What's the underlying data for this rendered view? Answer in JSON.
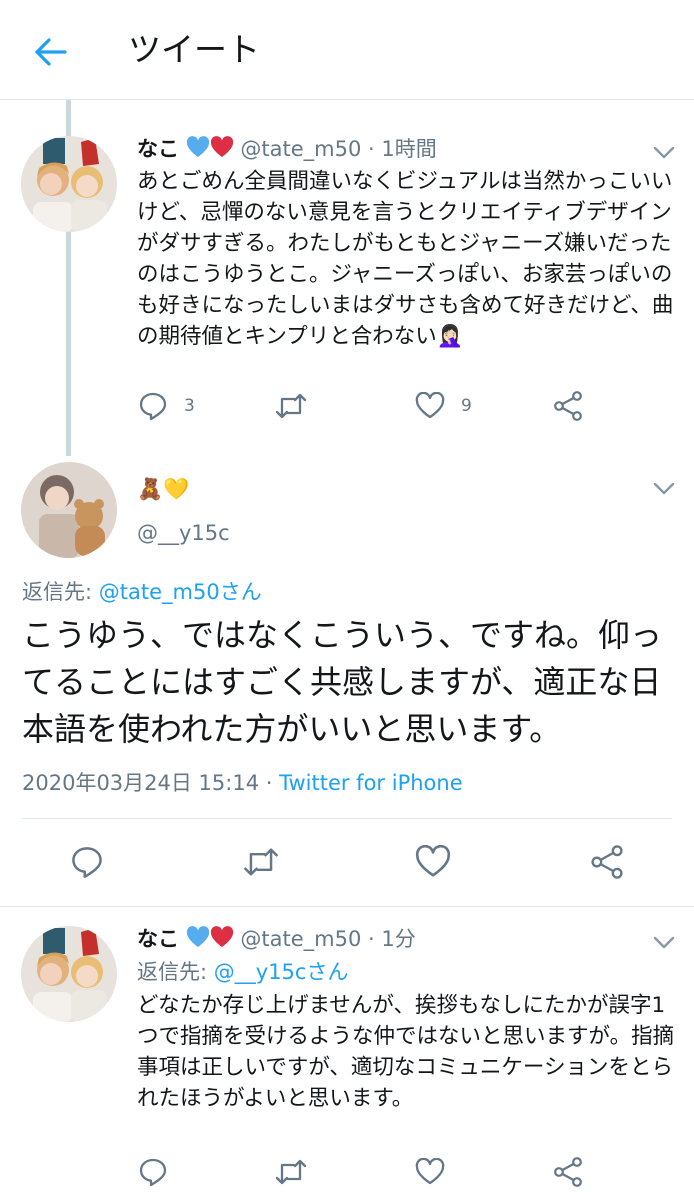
{
  "header": {
    "title": "ツイート"
  },
  "tweets": [
    {
      "name": "なこ",
      "handle": "@tate_m50",
      "time": "· 1時間",
      "text": "あとごめん全員間違いなくビジュアルは当然かっこいいけど、忌憚のない意見を言うとクリエイティブデザインがダサすぎる。わたしがもともとジャニーズ嫌いだったのはこうゆうとこ。ジャニーズっぽい、お家芸っぽいのも好きになったしいまはダサさも含めて好きだけど、曲の期待値とキンプリと合わない🤦🏻‍♀️",
      "replies": "3",
      "likes": "9"
    },
    {
      "name": "🧸💛",
      "handle": "@__y15c",
      "reply_prefix": "返信先: ",
      "reply_to": "@tate_m50さん",
      "text": "こうゆう、ではなくこういう、ですね。仰ってることにはすごく共感しますが、適正な日本語を使われた方がいいと思います。",
      "date": "2020年03月24日 15:14",
      "source_sep": " · ",
      "source": "Twitter for iPhone"
    },
    {
      "name": "なこ",
      "handle": "@tate_m50",
      "time": "· 1分",
      "reply_prefix": "返信先: ",
      "reply_to": "@__y15cさん",
      "text": "どなたか存じ上げませんが、挨拶もなしにたかが誤字1つで指摘を受けるような仲ではないと思いますが。指摘事項は正しいですが、適切なコミュニケーションをとられたほうがよいと思います。"
    }
  ],
  "colors": {
    "accent": "#1da1f2",
    "text": "#14171a",
    "secondary": "#657786",
    "icon": "#657786",
    "heart_blue": "#55acee",
    "heart_red": "#dd2e44",
    "divider": "#e1e8ed"
  }
}
